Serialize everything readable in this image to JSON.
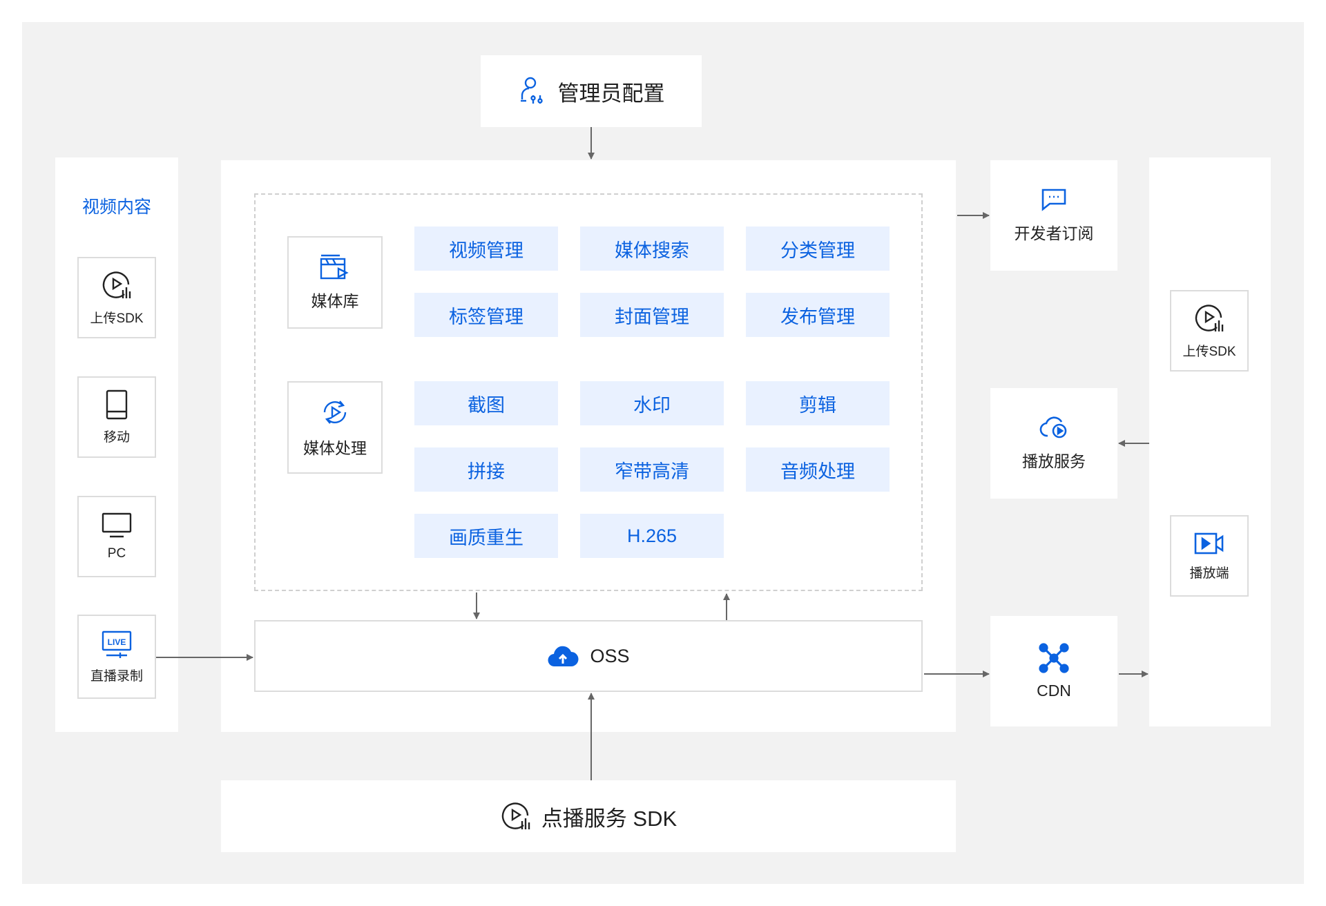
{
  "admin": {
    "label": "管理员配置",
    "icon": "admin-settings-icon"
  },
  "video_content": {
    "title": "视频内容",
    "items": [
      {
        "label": "上传SDK",
        "icon": "upload-sdk-icon"
      },
      {
        "label": "移动",
        "icon": "mobile-icon"
      },
      {
        "label": "PC",
        "icon": "monitor-icon"
      },
      {
        "label": "直播录制",
        "icon": "live-icon"
      }
    ]
  },
  "media_library": {
    "label": "媒体库",
    "icon": "clapperboard-icon",
    "features": [
      "视频管理",
      "媒体搜索",
      "分类管理",
      "标签管理",
      "封面管理",
      "发布管理"
    ]
  },
  "media_processing": {
    "label": "媒体处理",
    "icon": "process-play-icon",
    "features": [
      "截图",
      "水印",
      "剪辑",
      "拼接",
      "窄带高清",
      "音频处理",
      "画质重生",
      "H.265"
    ]
  },
  "oss": {
    "label": "OSS",
    "icon": "cloud-upload-icon"
  },
  "sdk": {
    "label": "点播服务 SDK",
    "icon": "vod-sdk-icon"
  },
  "services": {
    "developer": {
      "label": "开发者订阅",
      "icon": "message-icon"
    },
    "playback": {
      "label": "播放服务",
      "icon": "cloud-play-icon"
    },
    "cdn": {
      "label": "CDN",
      "icon": "network-icon"
    }
  },
  "client": {
    "items": [
      {
        "label": "上传SDK",
        "icon": "upload-sdk-icon"
      },
      {
        "label": "播放端",
        "icon": "player-icon"
      }
    ]
  },
  "colors": {
    "accent": "#0b62e0",
    "feature_bg": "#e9f1ff",
    "canvas": "#f2f2f2",
    "arrow": "#666666"
  }
}
